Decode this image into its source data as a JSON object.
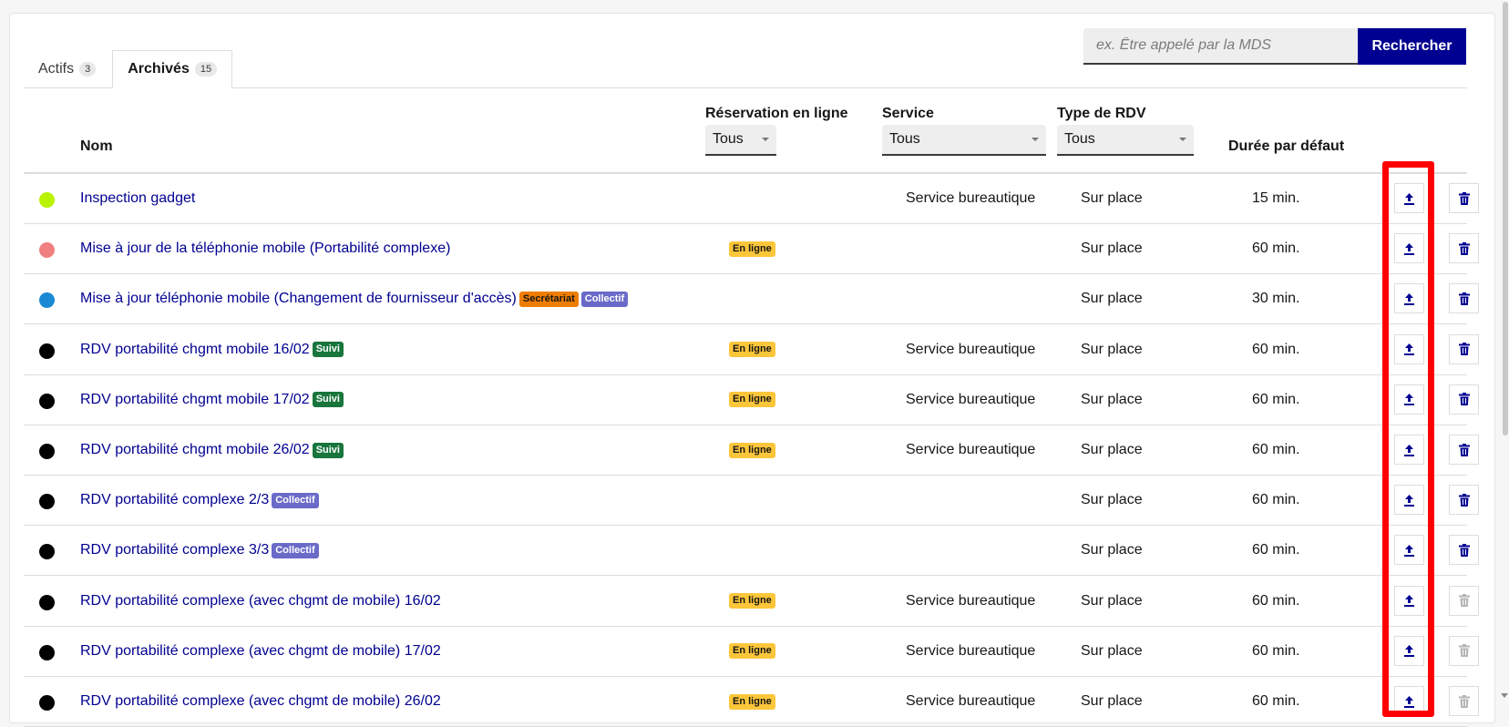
{
  "tabs": [
    {
      "label": "Actifs",
      "count": "3"
    },
    {
      "label": "Archivés",
      "count": "15"
    }
  ],
  "search": {
    "placeholder": "ex. Être appelé par la MDS",
    "button": "Rechercher"
  },
  "columns": {
    "name": "Nom",
    "online": "Réservation en ligne",
    "service": "Service",
    "type": "Type de RDV",
    "duration": "Durée par défaut"
  },
  "filters": {
    "online": "Tous",
    "service": "Tous",
    "type": "Tous"
  },
  "icons": {
    "unarchive": "upload-icon",
    "delete": "trash-icon"
  },
  "colors": {
    "primary": "#000091",
    "highlight": "#ff0000"
  },
  "rows": [
    {
      "color": "#b9f300",
      "name": "Inspection gadget",
      "badges": [],
      "online": "",
      "service": "Service bureautique",
      "type": "Sur place",
      "duration": "15 min.",
      "deletable": true
    },
    {
      "color": "#f08080",
      "name": "Mise à jour de la téléphonie mobile (Portabilité complexe)",
      "badges": [],
      "online": "En ligne",
      "service": "",
      "type": "Sur place",
      "duration": "60 min.",
      "deletable": true
    },
    {
      "color": "#1a8ad4",
      "name": "Mise à jour téléphonie mobile (Changement de fournisseur d'accès)",
      "badges": [
        "Secrétariat",
        "Collectif"
      ],
      "online": "",
      "service": "",
      "type": "Sur place",
      "duration": "30 min.",
      "deletable": true
    },
    {
      "color": "#000000",
      "name": "RDV portabilité chgmt mobile 16/02",
      "badges": [
        "Suivi"
      ],
      "online": "En ligne",
      "service": "Service bureautique",
      "type": "Sur place",
      "duration": "60 min.",
      "deletable": true
    },
    {
      "color": "#000000",
      "name": "RDV portabilité chgmt mobile 17/02",
      "badges": [
        "Suivi"
      ],
      "online": "En ligne",
      "service": "Service bureautique",
      "type": "Sur place",
      "duration": "60 min.",
      "deletable": true
    },
    {
      "color": "#000000",
      "name": "RDV portabilité chgmt mobile 26/02",
      "badges": [
        "Suivi"
      ],
      "online": "En ligne",
      "service": "Service bureautique",
      "type": "Sur place",
      "duration": "60 min.",
      "deletable": true
    },
    {
      "color": "#000000",
      "name": "RDV portabilité complexe 2/3",
      "badges": [
        "Collectif"
      ],
      "online": "",
      "service": "",
      "type": "Sur place",
      "duration": "60 min.",
      "deletable": true
    },
    {
      "color": "#000000",
      "name": "RDV portabilité complexe 3/3",
      "badges": [
        "Collectif"
      ],
      "online": "",
      "service": "",
      "type": "Sur place",
      "duration": "60 min.",
      "deletable": true
    },
    {
      "color": "#000000",
      "name": "RDV portabilité complexe (avec chgmt de mobile) 16/02",
      "badges": [],
      "online": "En ligne",
      "service": "Service bureautique",
      "type": "Sur place",
      "duration": "60 min.",
      "deletable": false
    },
    {
      "color": "#000000",
      "name": "RDV portabilité complexe (avec chgmt de mobile) 17/02",
      "badges": [],
      "online": "En ligne",
      "service": "Service bureautique",
      "type": "Sur place",
      "duration": "60 min.",
      "deletable": false
    },
    {
      "color": "#000000",
      "name": "RDV portabilité complexe (avec chgmt de mobile) 26/02",
      "badges": [],
      "online": "En ligne",
      "service": "Service bureautique",
      "type": "Sur place",
      "duration": "60 min.",
      "deletable": false
    }
  ]
}
